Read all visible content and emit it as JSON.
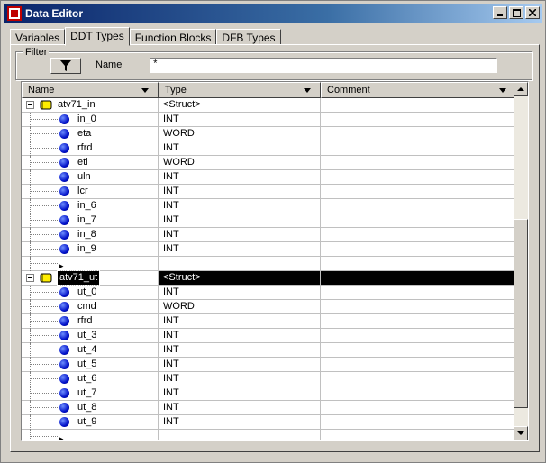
{
  "window": {
    "title": "Data Editor"
  },
  "tabs": [
    {
      "label": "Variables",
      "active": false
    },
    {
      "label": "DDT Types",
      "active": true
    },
    {
      "label": "Function Blocks",
      "active": false
    },
    {
      "label": "DFB Types",
      "active": false
    }
  ],
  "filter": {
    "legend": "Filter",
    "name_label": "Name",
    "value": "*"
  },
  "columns": [
    "Name",
    "Type",
    "Comment"
  ],
  "rows": [
    {
      "name": "atv71_in",
      "type": "<Struct>",
      "kind": "struct"
    },
    {
      "name": "in_0",
      "type": "INT",
      "kind": "elem"
    },
    {
      "name": "eta",
      "type": "WORD",
      "kind": "elem"
    },
    {
      "name": "rfrd",
      "type": "INT",
      "kind": "elem"
    },
    {
      "name": "eti",
      "type": "WORD",
      "kind": "elem"
    },
    {
      "name": "uln",
      "type": "INT",
      "kind": "elem"
    },
    {
      "name": "lcr",
      "type": "INT",
      "kind": "elem"
    },
    {
      "name": "in_6",
      "type": "INT",
      "kind": "elem"
    },
    {
      "name": "in_7",
      "type": "INT",
      "kind": "elem"
    },
    {
      "name": "in_8",
      "type": "INT",
      "kind": "elem"
    },
    {
      "name": "in_9",
      "type": "INT",
      "kind": "elem"
    },
    {
      "name": "",
      "type": "",
      "kind": "new"
    },
    {
      "name": "atv71_ut",
      "type": "<Struct>",
      "kind": "struct",
      "selected": true
    },
    {
      "name": "ut_0",
      "type": "INT",
      "kind": "elem"
    },
    {
      "name": "cmd",
      "type": "WORD",
      "kind": "elem"
    },
    {
      "name": "rfrd",
      "type": "INT",
      "kind": "elem"
    },
    {
      "name": "ut_3",
      "type": "INT",
      "kind": "elem"
    },
    {
      "name": "ut_4",
      "type": "INT",
      "kind": "elem"
    },
    {
      "name": "ut_5",
      "type": "INT",
      "kind": "elem"
    },
    {
      "name": "ut_6",
      "type": "INT",
      "kind": "elem"
    },
    {
      "name": "ut_7",
      "type": "INT",
      "kind": "elem"
    },
    {
      "name": "ut_8",
      "type": "INT",
      "kind": "elem"
    },
    {
      "name": "ut_9",
      "type": "INT",
      "kind": "elem"
    },
    {
      "name": "",
      "type": "",
      "kind": "new"
    }
  ],
  "icons": {
    "element": "blue-dot-icon",
    "struct": "struct-folder-icon",
    "new_row": "new-row-pointer-icon"
  },
  "colors": {
    "title_bar": "#0a246a",
    "selection": "#000000",
    "element_dot": "#0010c8",
    "struct_icon": "#ffee00"
  }
}
